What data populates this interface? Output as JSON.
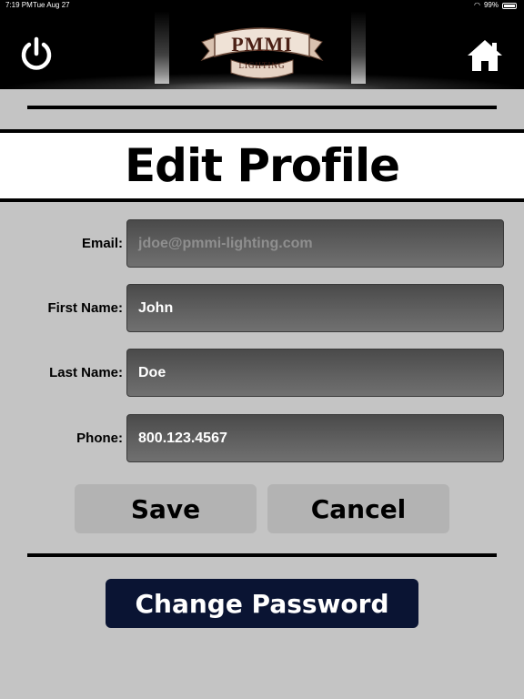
{
  "status_bar": {
    "time": "7:19 PM",
    "date": "Tue Aug 27",
    "battery": "99%"
  },
  "header": {
    "logo_text": "PMMI",
    "logo_subtext": "LIGHTING",
    "power_icon": "power-icon",
    "home_icon": "home-icon"
  },
  "page": {
    "title": "Edit Profile"
  },
  "form": {
    "email": {
      "label": "Email:",
      "placeholder": "jdoe@pmmi-lighting.com",
      "value": ""
    },
    "first_name": {
      "label": "First Name:",
      "value": "John"
    },
    "last_name": {
      "label": "Last Name:",
      "value": "Doe"
    },
    "phone": {
      "label": "Phone:",
      "value": "800.123.4567"
    }
  },
  "actions": {
    "save_label": "Save",
    "cancel_label": "Cancel",
    "change_password_label": "Change Password"
  },
  "colors": {
    "background": "#c4c4c4",
    "header": "#000000",
    "field": "#5a5a5a",
    "button": "#b3b3b3",
    "change_password": "#0a1433"
  }
}
